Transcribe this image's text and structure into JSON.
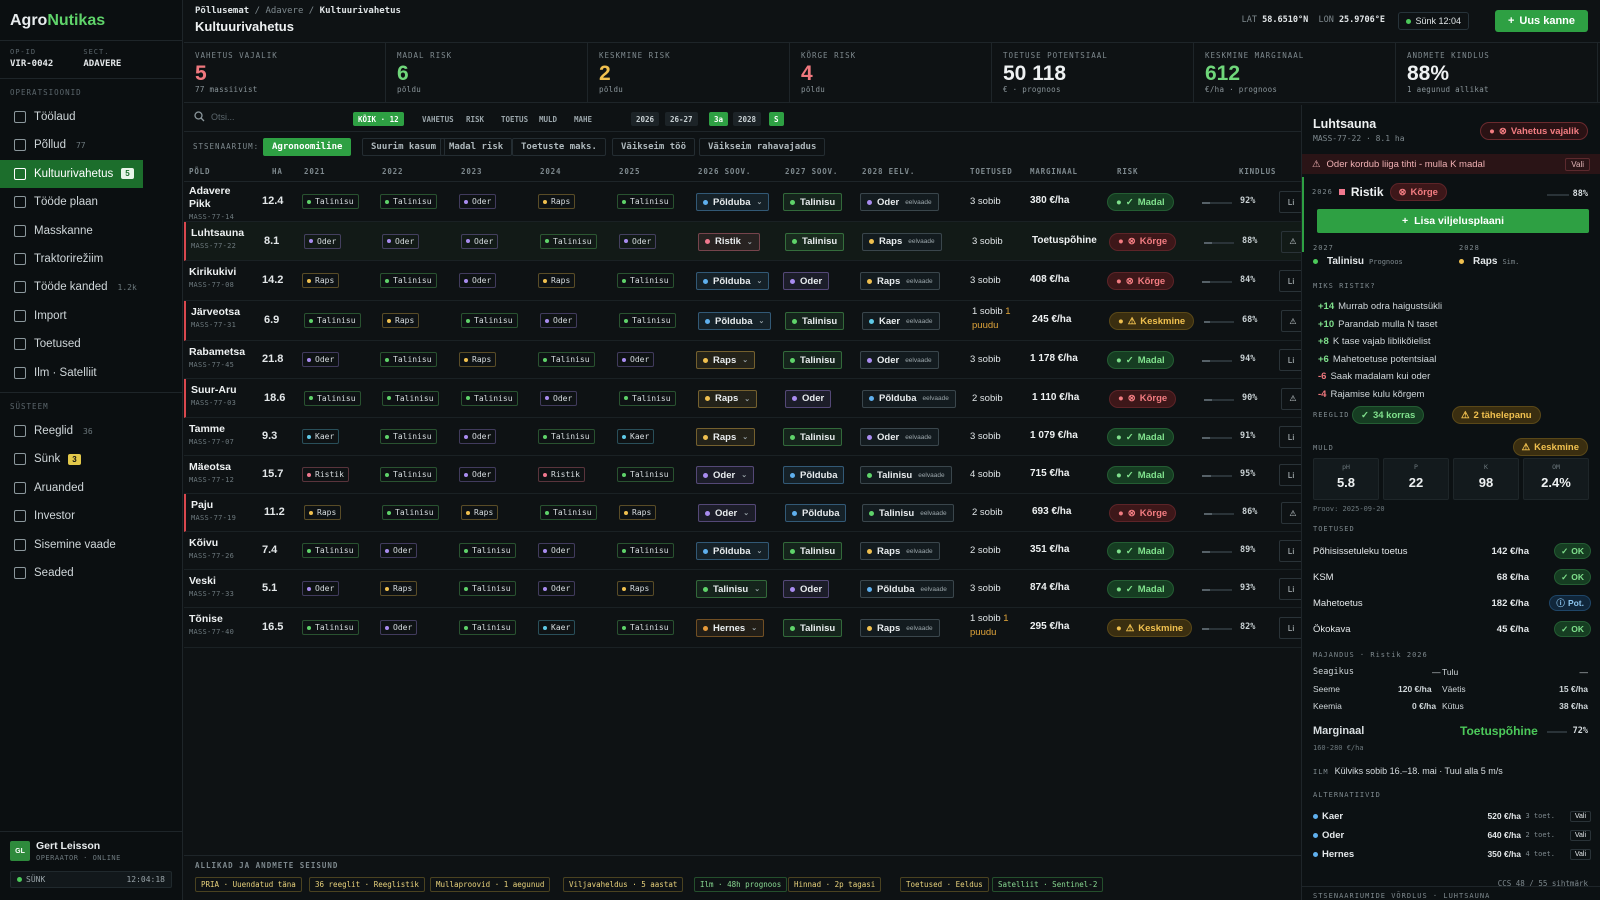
{
  "brand": {
    "name_a": "Agro",
    "name_b": "Nutikas"
  },
  "sidebar": {
    "op_id_label": "OP-ID",
    "op_id": "VIR-0042",
    "sect_label": "SECT.",
    "sect": "ADAVERE",
    "section_ops": "OPERATSIOONID",
    "section_sys": "SÜSTEEM",
    "ops": [
      {
        "label": "Töölaud",
        "icon": "dashboard-icon"
      },
      {
        "label": "Põllud",
        "count": "77",
        "icon": "map-icon"
      },
      {
        "label": "Kultuurivahetus",
        "badge": "5",
        "icon": "sprout-icon",
        "active": true
      },
      {
        "label": "Tööde plaan",
        "icon": "calendar-icon"
      },
      {
        "label": "Masskanne",
        "icon": "bolt-icon"
      },
      {
        "label": "Traktorirežiim",
        "icon": "tractor-icon"
      },
      {
        "label": "Tööde kanded",
        "count": "1.2k",
        "icon": "activity-icon"
      },
      {
        "label": "Import",
        "icon": "upload-icon"
      },
      {
        "label": "Toetused",
        "icon": "euro-icon"
      },
      {
        "label": "Ilm · Satelliit",
        "icon": "satellite-icon"
      }
    ],
    "sys": [
      {
        "label": "Reeglid",
        "count": "36",
        "icon": "shield-icon"
      },
      {
        "label": "Sünk",
        "badge": "3",
        "icon": "sync-icon"
      },
      {
        "label": "Aruanded",
        "icon": "report-icon"
      },
      {
        "label": "Investor",
        "icon": "chart-icon"
      },
      {
        "label": "Sisemine vaade",
        "icon": "gear-icon"
      },
      {
        "label": "Seaded",
        "icon": "settings-icon"
      }
    ],
    "user": {
      "initials": "GL",
      "name": "Gert Leisson",
      "role": "OPERAATOR · ONLINE"
    },
    "sync": {
      "label": "SÜNK",
      "time": "12:04:18"
    }
  },
  "header": {
    "crumb1": "Põllusemat",
    "crumb2": "Adavere",
    "crumb3": "Kultuurivahetus",
    "title": "Kultuurivahetus",
    "lat_label": "LAT",
    "lat": "58.6510°N",
    "lon_label": "LON",
    "lon": "25.9706°E",
    "sync": "Sünk 12:04",
    "new_button": "Uus kanne"
  },
  "kpis": [
    {
      "label": "VAHETUS VAJALIK",
      "value": "5",
      "sub": "77 massiivist",
      "color": "#f0787e"
    },
    {
      "label": "MADAL RISK",
      "value": "6",
      "sub": "põldu",
      "color": "#6fd67a"
    },
    {
      "label": "KESKMINE RISK",
      "value": "2",
      "sub": "põldu",
      "color": "#f0c04f"
    },
    {
      "label": "KÕRGE RISK",
      "value": "4",
      "sub": "põldu",
      "color": "#f0787e"
    },
    {
      "label": "TOETUSE POTENTSIAAL",
      "value": "50 118",
      "sub": "€ · prognoos",
      "color": "#eef1f2"
    },
    {
      "label": "KESKMINE MARGINAAL",
      "value": "612",
      "sub": "€/ha · prognoos",
      "color": "#6fd67a"
    },
    {
      "label": "ANDMETE KINDLUS",
      "value": "88%",
      "sub": "1 aegunud allikat",
      "color": "#eef1f2"
    }
  ],
  "filters": {
    "search_placeholder": "Otsi...",
    "chips": [
      "KÕIK · 12",
      "VAHETUS",
      "RISK",
      "TOETUS",
      "MULD",
      "MAHE"
    ],
    "years": [
      "2026",
      "26-27",
      "3a",
      "2028",
      "S"
    ]
  },
  "scenario": {
    "label": "STSENAARIUM:",
    "options": [
      "Agronoomiline",
      "Suurim kasum",
      "Madal risk",
      "Toetuste maks.",
      "Väikseim töö",
      "Väikseim rahavajadus"
    ]
  },
  "table": {
    "headers": [
      "PÕLD",
      "HA",
      "2021",
      "2022",
      "2023",
      "2024",
      "2025",
      "2026 SOOV.",
      "2027 SOOV.",
      "2028 EELV.",
      "TOETUSED",
      "MARGINAAL",
      "RISK",
      "KINDLUS"
    ],
    "preview_label": "eelvaade",
    "trail": "Li",
    "rows": [
      {
        "name": "Adavere Pikk",
        "code": "MASS-77-14",
        "ha": "12.4",
        "h": [
          "Talinisu",
          "Talinisu",
          "Oder",
          "Raps",
          "Talinisu"
        ],
        "s26": "Põlduba",
        "s27": "Talinisu",
        "s28": "Oder",
        "toe": "3 sobib",
        "marg": "380 €/ha",
        "risk": "Madal",
        "rk": "low",
        "conf": "92%"
      },
      {
        "name": "Luhtsauna",
        "code": "MASS-77-22",
        "ha": "8.1",
        "h": [
          "Oder",
          "Oder",
          "Oder",
          "Talinisu",
          "Oder"
        ],
        "s26": "Ristik",
        "s27": "Talinisu",
        "s28": "Raps",
        "toe": "3 sobib",
        "marg": "Toetuspõhine",
        "risk": "Kõrge",
        "rk": "high",
        "conf": "88%",
        "warn": true,
        "sel": true
      },
      {
        "name": "Kirikukivi",
        "code": "MASS-77-08",
        "ha": "14.2",
        "h": [
          "Raps",
          "Talinisu",
          "Oder",
          "Raps",
          "Talinisu"
        ],
        "s26": "Põlduba",
        "s27": "Oder",
        "s28": "Raps",
        "toe": "3 sobib",
        "marg": "408 €/ha",
        "risk": "Kõrge",
        "rk": "high",
        "conf": "84%"
      },
      {
        "name": "Järveotsa",
        "code": "MASS-77-31",
        "ha": "6.9",
        "h": [
          "Talinisu",
          "Raps",
          "Talinisu",
          "Oder",
          "Talinisu"
        ],
        "s26": "Põlduba",
        "s27": "Talinisu",
        "s28": "Kaer",
        "toe": "1 sobib",
        "toe2": "1 puudu",
        "marg": "245 €/ha",
        "risk": "Keskmine",
        "rk": "mid",
        "conf": "68%",
        "warn": true
      },
      {
        "name": "Rabametsa",
        "code": "MASS-77-45",
        "ha": "21.8",
        "h": [
          "Oder",
          "Talinisu",
          "Raps",
          "Talinisu",
          "Oder"
        ],
        "s26": "Raps",
        "s27": "Talinisu",
        "s28": "Oder",
        "toe": "3 sobib",
        "marg": "1 178 €/ha",
        "risk": "Madal",
        "rk": "low",
        "conf": "94%"
      },
      {
        "name": "Suur-Aru",
        "code": "MASS-77-03",
        "ha": "18.6",
        "h": [
          "Talinisu",
          "Talinisu",
          "Talinisu",
          "Oder",
          "Talinisu"
        ],
        "s26": "Raps",
        "s27": "Oder",
        "s28": "Põlduba",
        "toe": "2 sobib",
        "marg": "1 110 €/ha",
        "risk": "Kõrge",
        "rk": "high",
        "conf": "90%",
        "warn": true
      },
      {
        "name": "Tamme",
        "code": "MASS-77-07",
        "ha": "9.3",
        "h": [
          "Kaer",
          "Talinisu",
          "Oder",
          "Talinisu",
          "Kaer"
        ],
        "s26": "Raps",
        "s27": "Talinisu",
        "s28": "Oder",
        "toe": "3 sobib",
        "marg": "1 079 €/ha",
        "risk": "Madal",
        "rk": "low",
        "conf": "91%"
      },
      {
        "name": "Mäeotsa",
        "code": "MASS-77-12",
        "ha": "15.7",
        "h": [
          "Ristik",
          "Talinisu",
          "Oder",
          "Ristik",
          "Talinisu"
        ],
        "s26": "Oder",
        "s27": "Põlduba",
        "s28": "Talinisu",
        "toe": "4 sobib",
        "marg": "715 €/ha",
        "risk": "Madal",
        "rk": "low",
        "conf": "95%"
      },
      {
        "name": "Paju",
        "code": "MASS-77-19",
        "ha": "11.2",
        "h": [
          "Raps",
          "Talinisu",
          "Raps",
          "Talinisu",
          "Raps"
        ],
        "s26": "Oder",
        "s27": "Põlduba",
        "s28": "Talinisu",
        "toe": "2 sobib",
        "marg": "693 €/ha",
        "risk": "Kõrge",
        "rk": "high",
        "conf": "86%",
        "warn": true
      },
      {
        "name": "Kõivu",
        "code": "MASS-77-26",
        "ha": "7.4",
        "h": [
          "Talinisu",
          "Oder",
          "Talinisu",
          "Oder",
          "Talinisu"
        ],
        "s26": "Põlduba",
        "s27": "Talinisu",
        "s28": "Raps",
        "toe": "2 sobib",
        "marg": "351 €/ha",
        "risk": "Madal",
        "rk": "low",
        "conf": "89%"
      },
      {
        "name": "Veski",
        "code": "MASS-77-33",
        "ha": "5.1",
        "h": [
          "Oder",
          "Raps",
          "Talinisu",
          "Oder",
          "Raps"
        ],
        "s26": "Talinisu",
        "s27": "Oder",
        "s28": "Põlduba",
        "toe": "3 sobib",
        "marg": "874 €/ha",
        "risk": "Madal",
        "rk": "low",
        "conf": "93%"
      },
      {
        "name": "Tõnise",
        "code": "MASS-77-40",
        "ha": "16.5",
        "h": [
          "Talinisu",
          "Oder",
          "Talinisu",
          "Kaer",
          "Talinisu"
        ],
        "s26": "Hernes",
        "s27": "Talinisu",
        "s28": "Raps",
        "toe": "1 sobib",
        "toe2": "1 puudu",
        "marg": "295 €/ha",
        "risk": "Keskmine",
        "rk": "mid",
        "conf": "82%"
      }
    ]
  },
  "sources": {
    "label": "ALLIKAD JA ANDMETE SEISUND",
    "chips": [
      {
        "t": "PRIA · Uuendatud täna",
        "g": false
      },
      {
        "t": "36 reeglit · Reeglistik",
        "g": false
      },
      {
        "t": "Mullaproovid · 1 aegunud",
        "g": false
      },
      {
        "t": "Viljavaheldus · 5 aastat",
        "g": false
      },
      {
        "t": "Ilm · 48h prognoos",
        "g": true
      },
      {
        "t": "Hinnad · 2p tagasi",
        "g": false
      },
      {
        "t": "Toetused · Eeldus",
        "g": false
      },
      {
        "t": "Satelliit · Sentinel-2",
        "g": true
      }
    ]
  },
  "panel": {
    "title": "Luhtsauna",
    "sub": "MASS-77-22 · 8.1 ha",
    "status": "Vahetus vajalik",
    "alert": "Oder kordub liiga tihti - mulla K madal",
    "alert_btn": "Vali",
    "year": "2026",
    "crop": "Ristik",
    "risk": "Kõrge",
    "conf": "88%",
    "plan_btn": "Lisa viljelusplaani",
    "y27": "2027",
    "c27": "Talinisu",
    "c27_tag": "Prognoos",
    "y28": "2028",
    "c28": "Raps",
    "c28_tag": "Sim.",
    "why_label": "MIKS RISTIK?",
    "why": [
      {
        "n": "+14",
        "t": "Murrab odra haigustsükli",
        "c": "#7fe08c"
      },
      {
        "n": "+10",
        "t": "Parandab mulla N taset",
        "c": "#7fe08c"
      },
      {
        "n": "+8",
        "t": "K tase vajab liblikõielist",
        "c": "#7fe08c"
      },
      {
        "n": "+6",
        "t": "Mahetoetuse potentsiaal",
        "c": "#7fe08c"
      },
      {
        "n": "-6",
        "t": "Saak madalam kui oder",
        "c": "#f0787e"
      },
      {
        "n": "-4",
        "t": "Rajamise kulu kõrgem",
        "c": "#f0787e"
      }
    ],
    "rules_label": "REEGLID",
    "rules_ok": "34 korras",
    "rules_warn": "2 tähelepanu",
    "soil_label": "MULD",
    "soil_status": "Keskmine",
    "soil": [
      {
        "l": "pH",
        "v": "5.8"
      },
      {
        "l": "P",
        "v": "22"
      },
      {
        "l": "K",
        "v": "98"
      },
      {
        "l": "OM",
        "v": "2.4%"
      }
    ],
    "soil_date": "Proov: 2025-09-20",
    "subs_label": "TOETUSED",
    "subs": [
      {
        "n": "Põhisissetuleku toetus",
        "a": "142 €/ha",
        "s": "OK",
        "k": "ok"
      },
      {
        "n": "KSM",
        "a": "68 €/ha",
        "s": "OK",
        "k": "ok"
      },
      {
        "n": "Mahetoetus",
        "a": "182 €/ha",
        "s": "Pot.",
        "k": "pot"
      },
      {
        "n": "Ökokava",
        "a": "45 €/ha",
        "s": "OK",
        "k": "ok"
      }
    ],
    "econ_label": "MAJANDUS · Ristik 2026",
    "econ": {
      "seeds_l": "Seagikus",
      "seeds_v": "—",
      "tulu_l": "Tulu",
      "tulu_v": "—",
      "seme_l": "Seeme",
      "seme_v": "120 €/ha",
      "vaet_l": "Väetis",
      "vaet_v": "15 €/ha",
      "keem_l": "Keemia",
      "keem_v": "0 €/ha",
      "kyt_l": "Kütus",
      "kyt_v": "38 €/ha"
    },
    "marg_label": "Marginaal",
    "marg_val": "Toetuspõhine",
    "marg_pct": "72%",
    "marg_range": "160-280 €/ha",
    "ilm_label": "ILM",
    "ilm": "Külviks sobib 16.–18. mai · Tuul alla 5 m/s",
    "alt_label": "ALTERNATIIVID",
    "alts": [
      {
        "n": "Kaer",
        "p": "520 €/ha",
        "t": "3 toet.",
        "c": "#5fb0ee"
      },
      {
        "n": "Oder",
        "p": "640 €/ha",
        "t": "2 toet.",
        "c": "#5fb0ee"
      },
      {
        "n": "Hernes",
        "p": "350 €/ha",
        "t": "4 toet.",
        "c": "#5fb0ee"
      }
    ],
    "alt_btn": "Vali",
    "ccs": "CCS 48 / 55 sihtmärk",
    "compare": "STSENAARIUMIDE VÕRDLUS · LUHTSAUNA"
  },
  "colors": {
    "Talinisu": "#5fd36a",
    "Oder": "#a98cf0",
    "Raps": "#f0c04f",
    "Ristik": "#f0788e",
    "Kaer": "#5fc9e6",
    "Põlduba": "#5fb0ee",
    "Hernes": "#e89a3a"
  }
}
